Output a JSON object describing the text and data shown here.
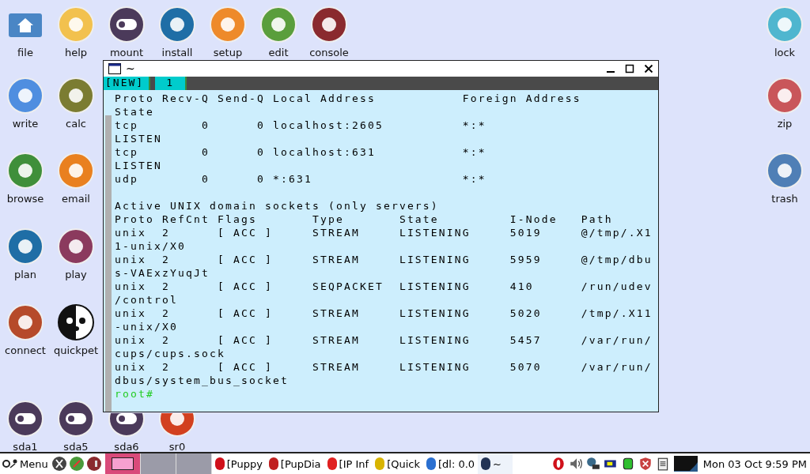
{
  "desktop": {
    "left_rows": [
      [
        {
          "label": "file",
          "kind": "folder",
          "color": "#4a86c5"
        },
        {
          "label": "help",
          "kind": "round",
          "color": "#f2c14e"
        },
        {
          "label": "mount",
          "kind": "toggle",
          "color": "#4b3a5a"
        },
        {
          "label": "install",
          "kind": "round",
          "color": "#1f6ea6"
        },
        {
          "label": "setup",
          "kind": "round",
          "color": "#ee8a2a"
        },
        {
          "label": "edit",
          "kind": "round",
          "color": "#5a9e3c"
        },
        {
          "label": "console",
          "kind": "round",
          "color": "#8a2a2e"
        }
      ],
      [
        {
          "label": "write",
          "kind": "round",
          "color": "#4f8ee0"
        },
        {
          "label": "calc",
          "kind": "round",
          "color": "#7b7c32"
        }
      ],
      [
        {
          "label": "browse",
          "kind": "round",
          "color": "#3f8f3a"
        },
        {
          "label": "email",
          "kind": "round",
          "color": "#e9801f"
        }
      ],
      [
        {
          "label": "plan",
          "kind": "round",
          "color": "#1f6ea6"
        },
        {
          "label": "play",
          "kind": "round",
          "color": "#8b3a5e"
        }
      ],
      [
        {
          "label": "connect",
          "kind": "round",
          "color": "#b64a2a"
        },
        {
          "label": "quickpet",
          "kind": "pet",
          "color": "#111111"
        }
      ],
      [
        {
          "label": "sda1",
          "kind": "toggle",
          "color": "#4b3a5a"
        },
        {
          "label": "sda5",
          "kind": "toggle",
          "color": "#4b3a5a"
        },
        {
          "label": "sda6",
          "kind": "toggle",
          "color": "#4b3a5a"
        },
        {
          "label": "sr0",
          "kind": "round",
          "color": "#d2401f"
        }
      ]
    ],
    "right_icons": [
      {
        "label": "lock",
        "kind": "round",
        "color": "#4fb6cf"
      },
      {
        "label": "zip",
        "kind": "round",
        "color": "#c9565a"
      },
      {
        "label": "trash",
        "kind": "round",
        "color": "#4f7fb6"
      }
    ]
  },
  "terminal": {
    "title": "~",
    "tabs": [
      {
        "label": "[NEW]",
        "selected": false
      },
      {
        "label": "1",
        "selected": true
      }
    ],
    "blocks": [
      [
        "Proto Recv-Q Send-Q Local Address           Foreign Address",
        "State",
        "tcp        0      0 localhost:2605          *:*",
        "LISTEN",
        "tcp        0      0 localhost:631           *:*",
        "LISTEN",
        "udp        0      0 *:631                   *:*"
      ],
      [
        "Active UNIX domain sockets (only servers)",
        "Proto RefCnt Flags       Type       State         I-Node   Path",
        "unix  2      [ ACC ]     STREAM     LISTENING     5019     @/tmp/.X1",
        "1-unix/X0",
        "unix  2      [ ACC ]     STREAM     LISTENING     5959     @/tmp/dbu",
        "s-VAExzYuqJt",
        "unix  2      [ ACC ]     SEQPACKET  LISTENING     410      /run/udev",
        "/control",
        "unix  2      [ ACC ]     STREAM     LISTENING     5020     /tmp/.X11",
        "-unix/X0",
        "unix  2      [ ACC ]     STREAM     LISTENING     5457     /var/run/",
        "cups/cups.sock",
        "unix  2      [ ACC ]     STREAM     LISTENING     5070     /var/run/",
        "dbus/system_bus_socket"
      ]
    ],
    "prompt": "root#"
  },
  "taskbar": {
    "menu": "Menu",
    "desktops": [
      {
        "selected": true
      },
      {
        "selected": false
      },
      {
        "selected": false
      }
    ],
    "tasks": [
      {
        "label": "[Puppy",
        "selected": false,
        "color": "#d0101a"
      },
      {
        "label": "[PupDia",
        "selected": false,
        "color": "#c02020"
      },
      {
        "label": "[IP Inf",
        "selected": false,
        "color": "#e02020"
      },
      {
        "label": "[Quick",
        "selected": false,
        "color": "#d8b400"
      },
      {
        "label": "[dl: 0.0",
        "selected": false,
        "color": "#2a6fd0"
      },
      {
        "label": "~",
        "selected": true,
        "color": "#223355"
      }
    ],
    "clock": "Mon 03 Oct  9:59 PM"
  }
}
